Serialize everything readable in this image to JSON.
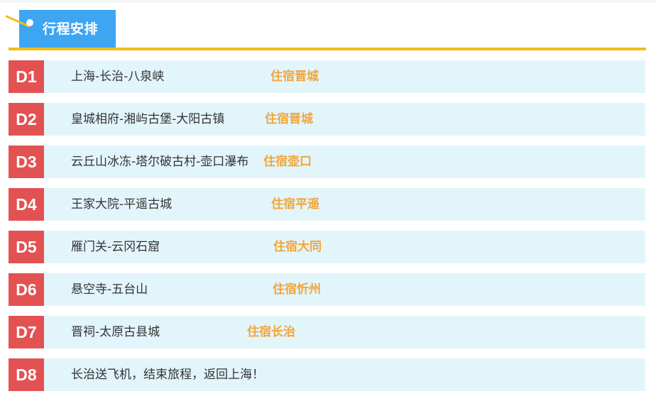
{
  "header": {
    "title": "行程安排"
  },
  "itinerary": [
    {
      "day": "D1",
      "route": "上海-长治-八泉峡",
      "stay": "住宿晋城"
    },
    {
      "day": "D2",
      "route": "皇城相府-湘屿古堡-大阳古镇",
      "stay": "住宿晋城"
    },
    {
      "day": "D3",
      "route": "云丘山冰冻-塔尔破古村-壶口瀑布",
      "stay": "住宿壶口"
    },
    {
      "day": "D4",
      "route": "王家大院-平遥古城",
      "stay": "住宿平遥"
    },
    {
      "day": "D5",
      "route": "雁门关-云冈石窟",
      "stay": "住宿大同"
    },
    {
      "day": "D6",
      "route": "悬空寺-五台山",
      "stay": "住宿忻州"
    },
    {
      "day": "D7",
      "route": "晋祠-太原古县城",
      "stay": "住宿长治"
    },
    {
      "day": "D8",
      "route": "长治送飞机，结束旅程，返回上海！",
      "stay": ""
    }
  ],
  "colors": {
    "header_bg": "#3ea5f3",
    "accent_yellow": "#f0be19",
    "day_badge": "#e35252",
    "row_bg": "#e2f5fb",
    "stay_text": "#f2a53a"
  },
  "icons": [
    "pin-icon"
  ]
}
